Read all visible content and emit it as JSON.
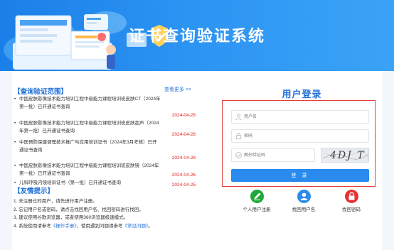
{
  "header": {
    "title": "证书查询验证系统"
  },
  "scope": {
    "title": "【查询验证范围】",
    "more": "查看更多 >>",
    "items": [
      {
        "title": "中国皮肤影像技术能力培训工程中级能力课程培训班皮肤CT（2024年第一批）已开通证书查询",
        "date": "2024-04-28"
      },
      {
        "title": "中国皮肤影像技术能力培训工程中级能力课程培训班皮肤超声（2024年第一批）已开通证书查询",
        "date": "2024-04-28"
      },
      {
        "title": "中医预防保健调理技术推广与应用培训证书（2024年3月考核）已开通证书查询",
        "date": "2024-04-28"
      },
      {
        "title": "中国皮肤影像技术能力培训工程中级能力课程培训班皮肤镜（2024年第一批）已开通证书查询",
        "date": "2024-04-26"
      },
      {
        "title": "儿科呼吸内镜培训证书（第一批）已开通证书查询",
        "date": "2024-04-25"
      }
    ]
  },
  "tips": {
    "title": "【友情提示】",
    "items": [
      {
        "pre": "1. 未注册过的用户，请先进行用户注册。",
        "link1": "",
        "mid": "",
        "link2": "",
        "post": ""
      },
      {
        "pre": "2. 忘记用户名或密码，请点击找回用户名、找回密码进行找回。",
        "link1": "",
        "mid": "",
        "link2": "",
        "post": ""
      },
      {
        "pre": "3. 建议使用谷歌浏览器，或者使用360浏览器极速模式。",
        "link1": "",
        "mid": "",
        "link2": "",
        "post": ""
      },
      {
        "pre": "4. 系统使用请参考",
        "link1": "《操作手册》",
        "mid": "，使用遇到问题请参考",
        "link2": "《常见问题》",
        "post": "。"
      }
    ]
  },
  "login": {
    "title": "用户登录",
    "username_placeholder": "用户名",
    "password_placeholder": "密码",
    "captcha_placeholder": "图形验证码",
    "captcha_text": "4DJ T",
    "submit": "登 录"
  },
  "actions": [
    {
      "label": "个人用户注册",
      "icon": "register-icon",
      "color": "#1fa83a"
    },
    {
      "label": "找回用户名",
      "icon": "user-icon",
      "color": "#2d8bea"
    },
    {
      "label": "找回密码",
      "icon": "lock-icon",
      "color": "#e33434"
    }
  ],
  "colors": {
    "brand": "#1f6fd8",
    "hero": "#2b93f2",
    "date": "#e02020",
    "highlight_border": "#e43b3b"
  }
}
